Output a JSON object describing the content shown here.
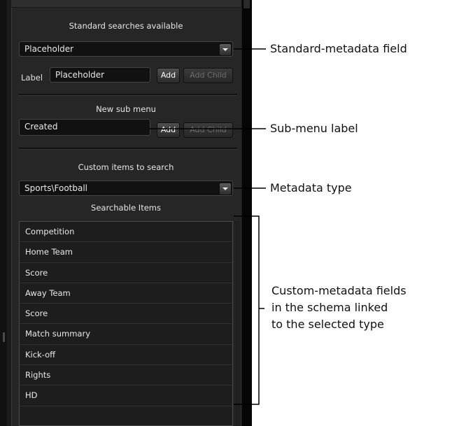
{
  "standard": {
    "header": "Standard searches available",
    "dropdown_value": "Placeholder",
    "label_caption": "Label",
    "label_value": "Placeholder",
    "add_button": "Add",
    "add_child_button": "Add Child"
  },
  "submenu": {
    "header": "New sub menu",
    "value": "Created",
    "add_button": "Add",
    "add_child_button": "Add Child"
  },
  "custom": {
    "header": "Custom items to search",
    "dropdown_value": "Sports\\Football",
    "searchable_header": "Searchable Items",
    "items": [
      "Competition",
      "Home Team",
      "Score",
      "Away Team",
      "Score",
      "Match summary",
      "Kick-off",
      "Rights",
      "HD"
    ]
  },
  "annotations": {
    "standard_field": "Standard-metadata field",
    "submenu_label": "Sub-menu label",
    "metadata_type": "Metadata type",
    "custom_fields": [
      "Custom-metadata fields",
      "in the schema linked",
      "to the selected type"
    ]
  }
}
